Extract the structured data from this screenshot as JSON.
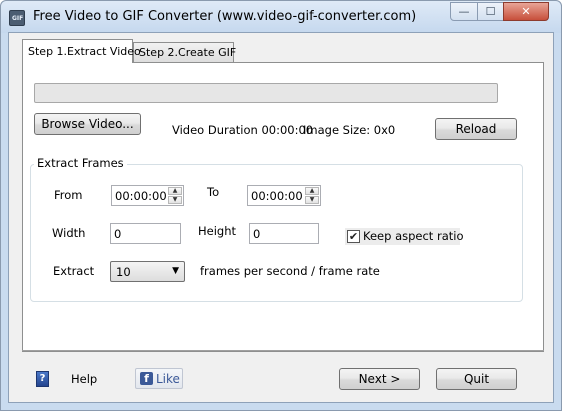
{
  "window": {
    "title": "Free Video to GIF Converter (www.video-gif-converter.com)",
    "icon_text": "GIF",
    "controls": {
      "minimize": "—",
      "maximize": "☐",
      "close": "✕"
    }
  },
  "tabs": [
    {
      "label": "Step 1.Extract Video",
      "active": true
    },
    {
      "label": "Step 2.Create GIF",
      "active": false
    }
  ],
  "video": {
    "browse_label": "Browse Video...",
    "duration_text": "Video Duration 00:00:00",
    "image_size_text": "Image Size: 0x0",
    "reload_label": "Reload",
    "progress": 0
  },
  "extract_frames": {
    "group_title": "Extract Frames",
    "from_label": "From",
    "from_value": "00:00:00",
    "to_label": "To",
    "to_value": "00:00:00",
    "width_label": "Width",
    "width_value": "0",
    "height_label": "Height",
    "height_value": "0",
    "keep_aspect_label": "Keep aspect ratio",
    "keep_aspect_checked": true,
    "extract_label": "Extract",
    "extract_value": "10",
    "rate_text": "frames per second / frame rate"
  },
  "footer": {
    "help_label": "Help",
    "like_label": "Like",
    "next_label": "Next >",
    "quit_label": "Quit"
  },
  "colors": {
    "frame": "#c9dbef",
    "facebook": "#3b5998"
  }
}
